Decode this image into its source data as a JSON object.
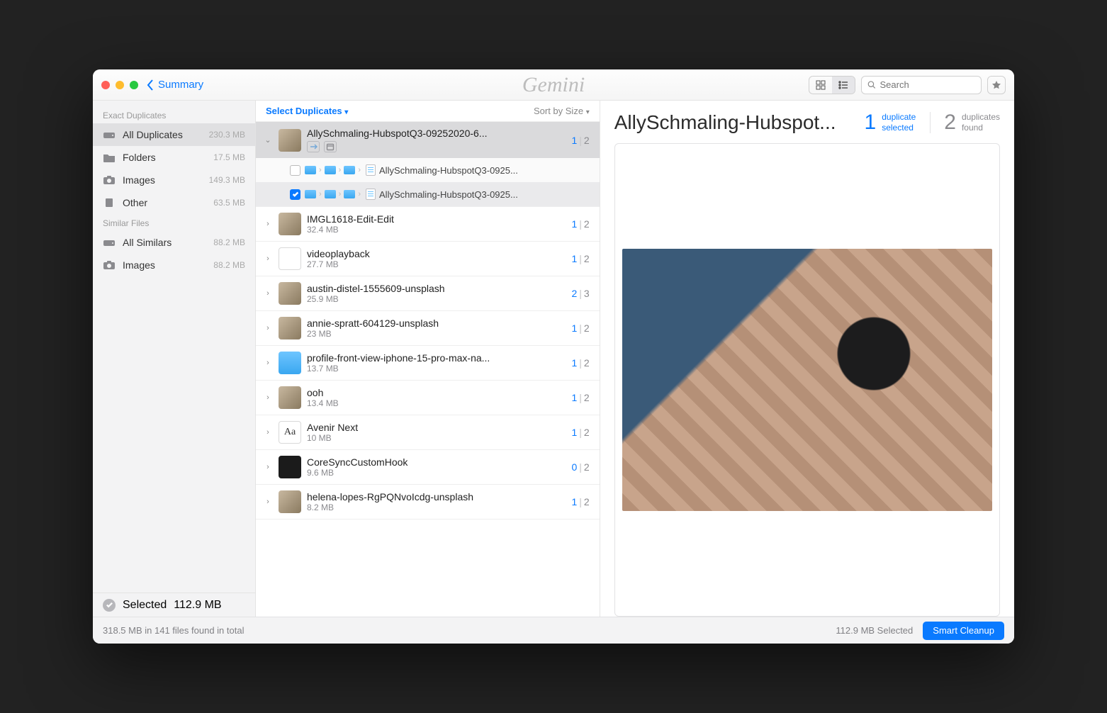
{
  "titlebar": {
    "back_label": "Summary",
    "app_name": "Gemini",
    "search_placeholder": "Search"
  },
  "sidebar": {
    "sections": [
      {
        "header": "Exact Duplicates",
        "items": [
          {
            "icon": "drive",
            "label": "All Duplicates",
            "size": "230.3 MB",
            "active": true
          },
          {
            "icon": "folder",
            "label": "Folders",
            "size": "17.5 MB"
          },
          {
            "icon": "camera",
            "label": "Images",
            "size": "149.3 MB"
          },
          {
            "icon": "doc",
            "label": "Other",
            "size": "63.5 MB"
          }
        ]
      },
      {
        "header": "Similar Files",
        "items": [
          {
            "icon": "drive",
            "label": "All Similars",
            "size": "88.2 MB"
          },
          {
            "icon": "camera",
            "label": "Images",
            "size": "88.2 MB"
          }
        ]
      }
    ],
    "selected": {
      "label": "Selected",
      "size": "112.9 MB"
    }
  },
  "list": {
    "select_label": "Select Duplicates",
    "sort_label": "Sort by Size",
    "groups": [
      {
        "title": "AllySchmaling-HubspotQ3-09252020-6...",
        "thumb": "photo",
        "selected": 1,
        "total": 2,
        "expanded": true,
        "children": [
          {
            "checked": false,
            "name": "AllySchmaling-HubspotQ3-0925..."
          },
          {
            "checked": true,
            "name": "AllySchmaling-HubspotQ3-0925..."
          }
        ]
      },
      {
        "title": "IMGL1618-Edit-Edit",
        "size": "32.4 MB",
        "thumb": "photo",
        "selected": 1,
        "total": 2
      },
      {
        "title": "videoplayback",
        "size": "27.7 MB",
        "thumb": "file",
        "selected": 1,
        "total": 2
      },
      {
        "title": "austin-distel-1555609-unsplash",
        "size": "25.9 MB",
        "thumb": "photo",
        "selected": 2,
        "total": 3
      },
      {
        "title": "annie-spratt-604129-unsplash",
        "size": "23 MB",
        "thumb": "photo",
        "selected": 1,
        "total": 2
      },
      {
        "title": "profile-front-view-iphone-15-pro-max-na...",
        "size": "13.7 MB",
        "thumb": "folder",
        "selected": 1,
        "total": 2
      },
      {
        "title": "ooh",
        "size": "13.4 MB",
        "thumb": "photo",
        "selected": 1,
        "total": 2
      },
      {
        "title": "Avenir Next",
        "size": "10 MB",
        "thumb": "font",
        "selected": 1,
        "total": 2
      },
      {
        "title": "CoreSyncCustomHook",
        "size": "9.6 MB",
        "thumb": "dark",
        "selected": 0,
        "total": 2
      },
      {
        "title": "helena-lopes-RgPQNvoIcdg-unsplash",
        "size": "8.2 MB",
        "thumb": "photo",
        "selected": 1,
        "total": 2
      }
    ]
  },
  "detail": {
    "title": "AllySchmaling-Hubspot...",
    "stats": [
      {
        "num": "1",
        "label_top": "duplicate",
        "label_bot": "selected",
        "tone": "blue"
      },
      {
        "num": "2",
        "label_top": "duplicates",
        "label_bot": "found",
        "tone": "grey"
      }
    ]
  },
  "footer": {
    "status": "318.5 MB in 141 files found in total",
    "selected_status": "112.9 MB Selected",
    "smart_cleanup": "Smart Cleanup"
  }
}
